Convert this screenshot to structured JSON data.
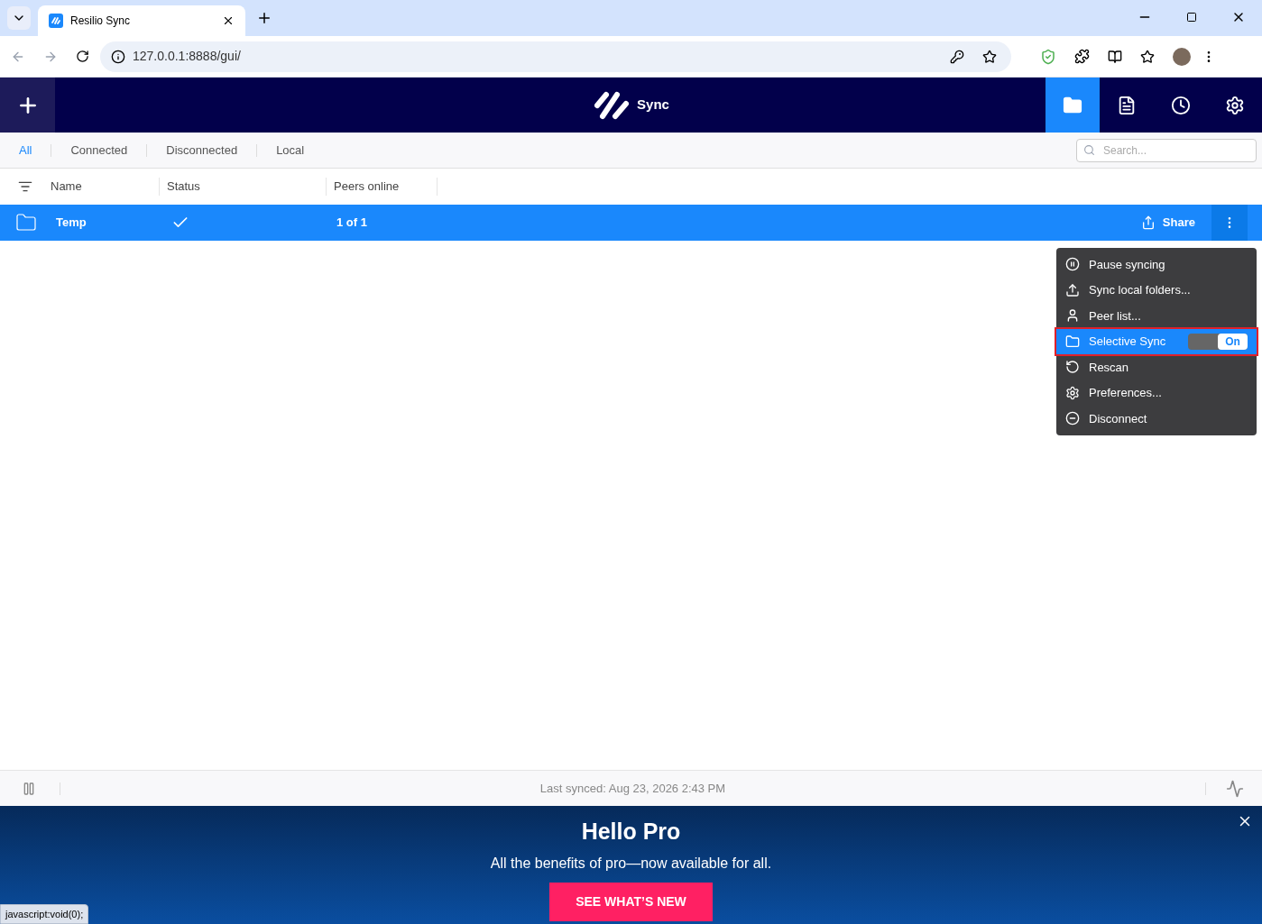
{
  "browser": {
    "tab_title": "Resilio Sync",
    "url": "127.0.0.1:8888/gui/",
    "status_link": "javascript:void(0);"
  },
  "app": {
    "logo_text": "Sync",
    "nav": [
      {
        "kind": "folders",
        "selected": true
      },
      {
        "kind": "log",
        "selected": false
      },
      {
        "kind": "history",
        "selected": false
      },
      {
        "kind": "settings",
        "selected": false
      }
    ]
  },
  "filters": [
    {
      "label": "All",
      "selected": true
    },
    {
      "label": "Connected",
      "selected": false
    },
    {
      "label": "Disconnected",
      "selected": false
    },
    {
      "label": "Local",
      "selected": false
    }
  ],
  "search": {
    "placeholder": "Search..."
  },
  "table": {
    "columns": [
      "Name",
      "Status",
      "Peers online"
    ],
    "rows": [
      {
        "name": "Temp",
        "peers": "1 of 1",
        "synced": true,
        "selected": true,
        "share": "Share"
      }
    ]
  },
  "menu": {
    "items": [
      {
        "kind": "pause",
        "label": "Pause syncing",
        "selected": false
      },
      {
        "kind": "upload",
        "label": "Sync local folders...",
        "selected": false
      },
      {
        "kind": "peers",
        "label": "Peer list...",
        "selected": false
      },
      {
        "kind": "folder",
        "label": "Selective Sync",
        "selected": true,
        "toggle": {
          "on": true,
          "label": "On"
        }
      },
      {
        "kind": "rescan",
        "label": "Rescan",
        "selected": false
      },
      {
        "kind": "settings",
        "label": "Preferences...",
        "selected": false
      },
      {
        "kind": "disconnect",
        "label": "Disconnect",
        "selected": false
      }
    ]
  },
  "status_bar": {
    "text": "Last synced: Aug 23, 2026 2:43 PM"
  },
  "banner": {
    "title": "Hello Pro",
    "text": "All the benefits of pro—now available for all.",
    "button": "SEE WHAT’S NEW"
  }
}
